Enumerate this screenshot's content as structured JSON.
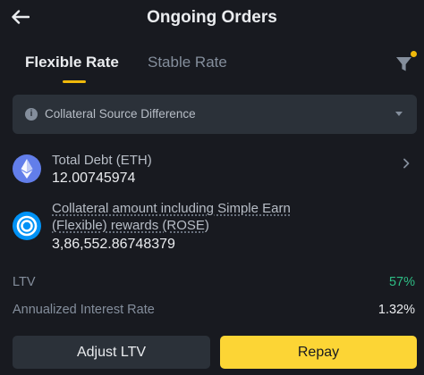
{
  "header": {
    "title": "Ongoing Orders",
    "back_icon": "arrow-left-icon"
  },
  "tabs": [
    {
      "label": "Flexible Rate",
      "active": true
    },
    {
      "label": "Stable Rate",
      "active": false
    }
  ],
  "filter": {
    "icon": "filter-icon",
    "has_notification": true
  },
  "info_banner": {
    "icon": "info-icon",
    "icon_glyph": "i",
    "text": "Collateral Source Difference",
    "caret_icon": "caret-down-icon"
  },
  "order": {
    "debt": {
      "coin_icon": "eth-icon",
      "label": "Total Debt (ETH)",
      "value": "12.00745974"
    },
    "collateral": {
      "coin_icon": "rose-icon",
      "label": "Collateral amount including Simple Earn (Flexible) rewards (ROSE)",
      "value": "3,86,552.86748379"
    },
    "ltv": {
      "label": "LTV",
      "value": "57%"
    },
    "interest": {
      "label": "Annualized Interest Rate",
      "value": "1.32%"
    }
  },
  "actions": {
    "adjust_label": "Adjust LTV",
    "repay_label": "Repay"
  },
  "colors": {
    "background": "#181a20",
    "accent": "#f0b90b",
    "repay_button": "#fcd535",
    "positive": "#2ebd85",
    "eth": "#627eea",
    "rose": "#0092f6"
  }
}
